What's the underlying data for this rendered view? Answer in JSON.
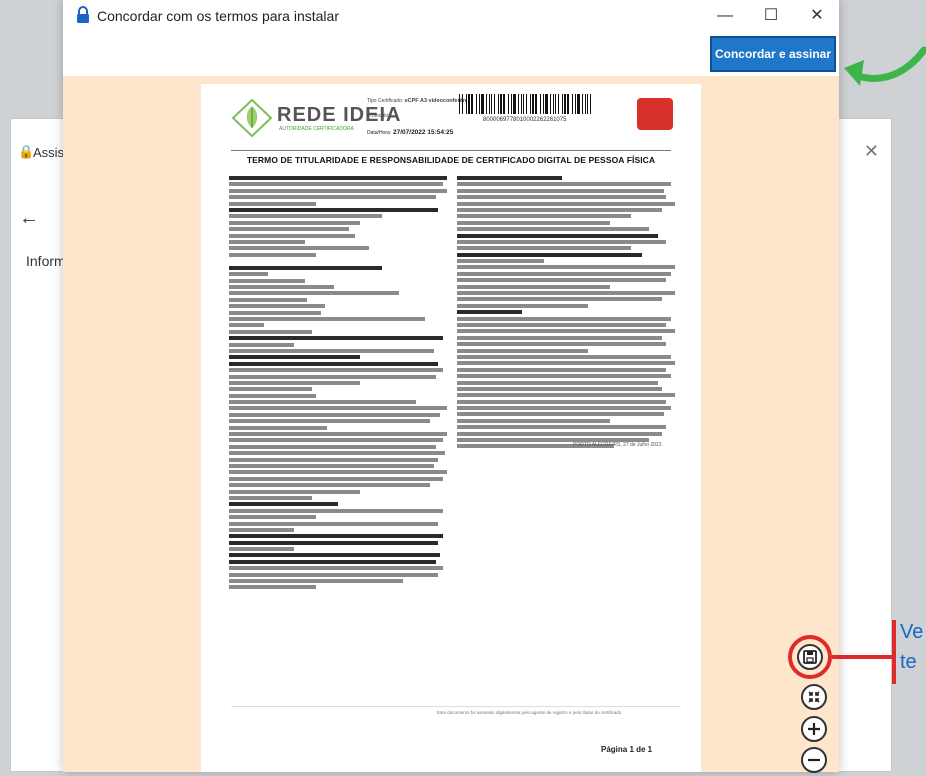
{
  "background_window": {
    "title": "Assis",
    "info_text": "Inform",
    "close_glyph": "✕",
    "back_glyph": "←"
  },
  "dialog": {
    "title": "Concordar com os termos para instalar",
    "controls": {
      "minimize": "—",
      "maximize": "☐",
      "close": "✕"
    },
    "agree_button": "Concordar e assinar"
  },
  "document": {
    "logo_text": "REDE IDEIA",
    "logo_subtitle": "AUTORIDADE CERTIFICADORA",
    "meta_type_label": "Tipo Certificado:",
    "meta_type_value": "eCPF A3 videoconferên",
    "meta_protocol_label": "Protocolo:",
    "meta_date_label": "Data/Hora:",
    "meta_date_value": "27/07/2022 15:54:25",
    "barcode_number": "8000069778010002262261075",
    "title": "TERMO DE TITULARIDADE E RESPONSABILIDADE DE CERTIFICADO DIGITAL DE PESSOA FÍSICA",
    "signature_place": "PORTO ALEGRE/RS, 27 de Julho 2022.",
    "footer_note": "Este documento foi assinado digitalmente pelo agente de registro e pelo titular do certificado",
    "page_number": "Página 1 de 1"
  },
  "viewer_controls": [
    {
      "name": "save-icon",
      "glyph": "💾"
    },
    {
      "name": "collapse-icon",
      "glyph": "⤡"
    },
    {
      "name": "zoom-in-icon",
      "glyph": "+"
    },
    {
      "name": "zoom-out-icon",
      "glyph": "−"
    }
  ],
  "annotation": {
    "line1": "Ve",
    "line2": "te"
  },
  "colors": {
    "accent_blue": "#1e77c8",
    "viewer_bg": "#fde6cc",
    "highlight_red": "#e02b2b",
    "arrow_green": "#3db54a"
  }
}
